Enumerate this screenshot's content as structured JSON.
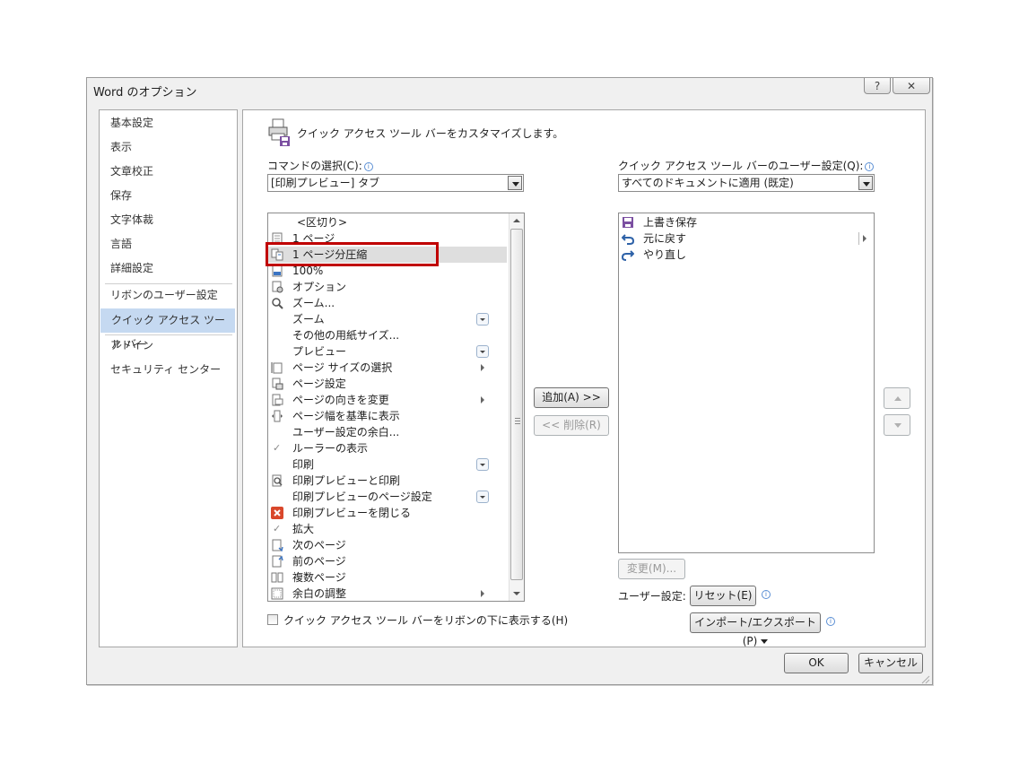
{
  "dialog": {
    "title": "Word のオプション",
    "help_label": "?",
    "close_label": "☒"
  },
  "nav": {
    "items": [
      {
        "label": "基本設定"
      },
      {
        "label": "表示"
      },
      {
        "label": "文章校正"
      },
      {
        "label": "保存"
      },
      {
        "label": "文字体裁"
      },
      {
        "label": "言語"
      },
      {
        "label": "詳細設定"
      },
      {
        "label": "リボンのユーザー設定"
      },
      {
        "label": "クイック アクセス ツール バー"
      },
      {
        "label": "アドイン"
      },
      {
        "label": "セキュリティ センター"
      }
    ],
    "selected": "クイック アクセス ツール バー"
  },
  "main": {
    "header": "クイック アクセス ツール バーをカスタマイズします。",
    "commands_label": "コマンドの選択(C):",
    "commands_combo_value": "[印刷プレビュー] タブ",
    "customize_label": "クイック アクセス ツール バーのユーザー設定(Q):",
    "customize_combo_value": "すべてのドキュメントに適用 (既定)",
    "commands": [
      {
        "label": "<区切り>",
        "icon": "separator"
      },
      {
        "label": "1 ページ",
        "icon": "page-icon"
      },
      {
        "label": "1 ページ分圧縮",
        "icon": "shrink-page-icon",
        "highlighted": true
      },
      {
        "label": "100%",
        "icon": "zoom-100-icon"
      },
      {
        "label": "オプション",
        "icon": "options-icon"
      },
      {
        "label": "ズーム...",
        "icon": "magnifier-icon"
      },
      {
        "label": "ズーム",
        "icon": "none",
        "dropdown": true
      },
      {
        "label": "その他の用紙サイズ...",
        "icon": "none"
      },
      {
        "label": "プレビュー",
        "icon": "none",
        "dropdown": true
      },
      {
        "label": "ページ サイズの選択",
        "icon": "page-size-icon",
        "submenu": true
      },
      {
        "label": "ページ設定",
        "icon": "page-setup-icon"
      },
      {
        "label": "ページの向きを変更",
        "icon": "orientation-icon",
        "submenu": true
      },
      {
        "label": "ページ幅を基準に表示",
        "icon": "page-width-icon"
      },
      {
        "label": "ユーザー設定の余白...",
        "icon": "none"
      },
      {
        "label": "ルーラーの表示",
        "icon": "check-icon"
      },
      {
        "label": "印刷",
        "icon": "none",
        "dropdown": true
      },
      {
        "label": "印刷プレビューと印刷",
        "icon": "print-preview-icon"
      },
      {
        "label": "印刷プレビューのページ設定",
        "icon": "none",
        "dropdown": true
      },
      {
        "label": "印刷プレビューを閉じる",
        "icon": "close-red-icon"
      },
      {
        "label": "拡大",
        "icon": "check-icon"
      },
      {
        "label": "次のページ",
        "icon": "next-page-icon"
      },
      {
        "label": "前のページ",
        "icon": "prev-page-icon"
      },
      {
        "label": "複数ページ",
        "icon": "multi-page-icon"
      },
      {
        "label": "余白の調整",
        "icon": "margins-icon",
        "submenu": true
      }
    ],
    "qat_items": [
      {
        "label": "上書き保存",
        "icon": "save-icon"
      },
      {
        "label": "元に戻す",
        "icon": "undo-icon",
        "submenu": true
      },
      {
        "label": "やり直し",
        "icon": "redo-icon"
      }
    ],
    "add_button": "追加(A) >>",
    "remove_button": "<< 削除(R)",
    "modify_button": "変更(M)...",
    "user_settings_label": "ユーザー設定:",
    "reset_button": "リセット(E)",
    "import_export_button": "インポート/エクスポート(P)",
    "show_below_ribbon_label": "クイック アクセス ツール バーをリボンの下に表示する(H)"
  },
  "footer": {
    "ok_button": "OK",
    "cancel_button": "キャンセル"
  },
  "colors": {
    "selected_nav": "#c5d9f1",
    "highlight_box": "#c00000",
    "dialog_bg": "#f0f0f0"
  }
}
